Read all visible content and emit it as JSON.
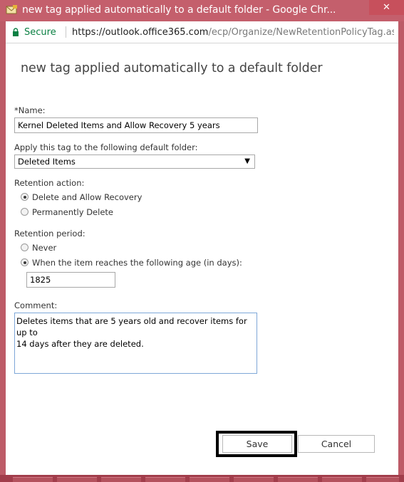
{
  "window": {
    "title": "new tag applied automatically to a default folder - Google Chr...",
    "close_glyph": "✕"
  },
  "addressbar": {
    "secure_label": "Secure",
    "url_host": "https://outlook.office365.com",
    "url_rest": "/ecp/Organize/NewRetentionPolicyTag.as..."
  },
  "page": {
    "title": "new tag applied automatically to a default folder"
  },
  "form": {
    "name_label": "*Name:",
    "name_value": "Kernel Deleted Items and Allow Recovery 5 years",
    "folder_label": "Apply this tag to the following default folder:",
    "folder_selected": "Deleted Items",
    "retention_action_label": "Retention action:",
    "action_options": [
      {
        "label": "Delete and Allow Recovery",
        "checked": true
      },
      {
        "label": "Permanently Delete",
        "checked": false
      }
    ],
    "retention_period_label": "Retention period:",
    "period_options": [
      {
        "label": "Never",
        "checked": false
      },
      {
        "label": "When the item reaches the following age (in days):",
        "checked": true
      }
    ],
    "age_days_value": "1825",
    "comment_label": "Comment:",
    "comment_line1": "Deletes items that are 5 years old and recover items for up to",
    "comment_line2": "14 days after they are deleted."
  },
  "buttons": {
    "save_label": "Save",
    "cancel_label": "Cancel"
  },
  "colors": {
    "frame": "#bd5b67",
    "secure_green": "#0b8043",
    "focus_border": "#7ea7d8"
  }
}
